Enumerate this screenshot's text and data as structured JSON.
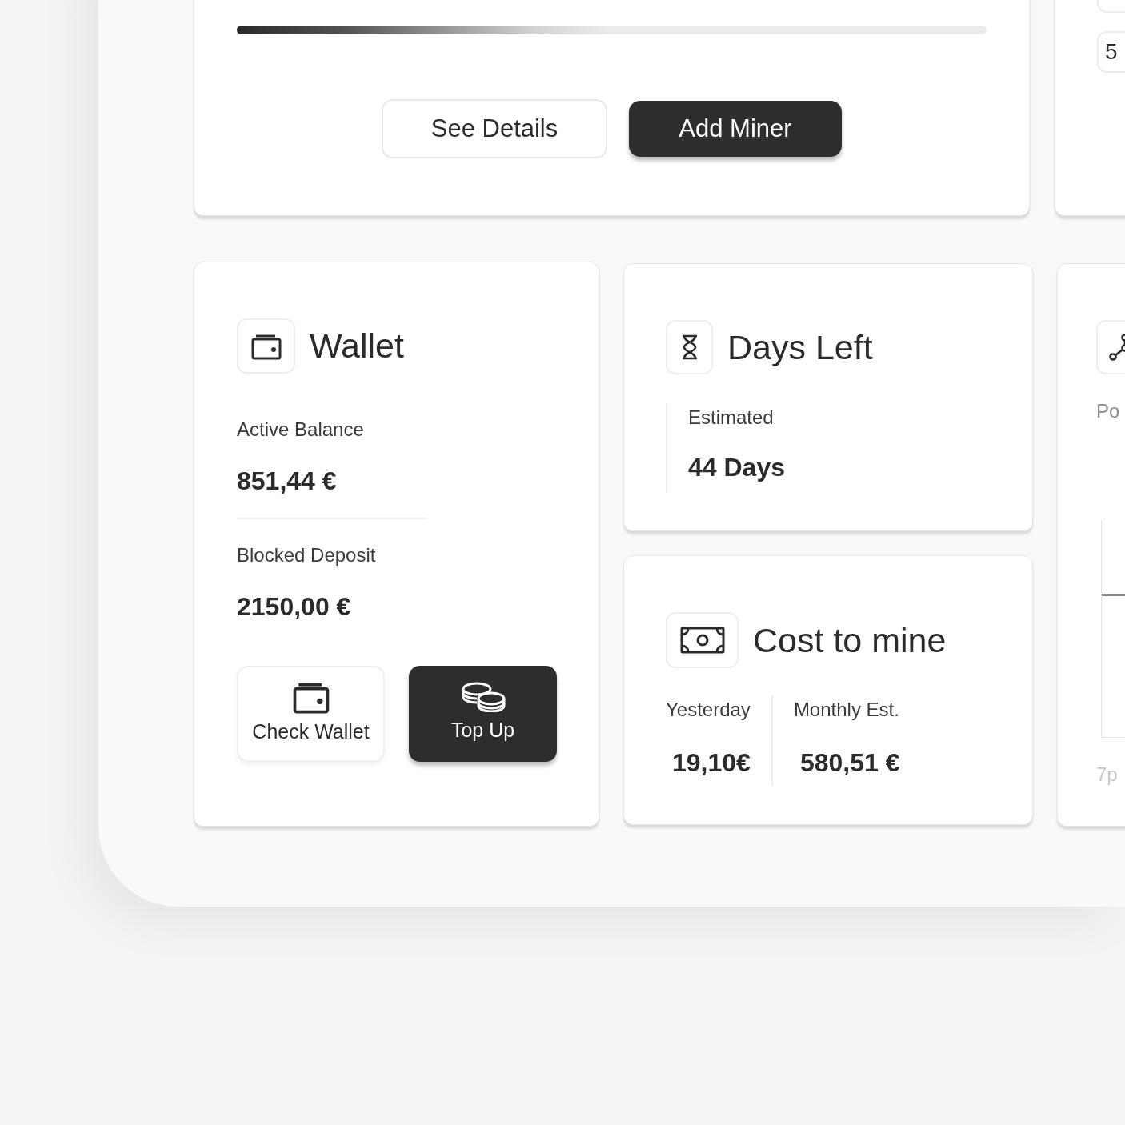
{
  "miner_card": {
    "progress": {
      "level": 0.5
    },
    "buttons": [
      {
        "label": "See Details",
        "kind": "outline"
      },
      {
        "label": "Add Miner",
        "kind": "dark"
      }
    ]
  },
  "side_card": {
    "chips": [
      "5"
    ]
  },
  "wallet": {
    "title": "Wallet",
    "rows": [
      {
        "label": "Active Balance",
        "value": "851,44 €"
      },
      {
        "label": "Blocked Deposit",
        "value": "2150,00 €"
      }
    ],
    "actions": [
      {
        "label": "Check Wallet",
        "kind": "light"
      },
      {
        "label": "Top Up",
        "kind": "dark"
      }
    ]
  },
  "days_left": {
    "title": "Days Left",
    "label": "Estimated",
    "value": "44 Days"
  },
  "cost_to_mine": {
    "title": "Cost to mine",
    "stats": [
      {
        "label": "Yesterday",
        "value": "19,10€"
      },
      {
        "label": "Monthly Est.",
        "value": "580,51 €"
      }
    ]
  },
  "pool_card": {
    "label": "Po",
    "axis_label": "7p"
  }
}
